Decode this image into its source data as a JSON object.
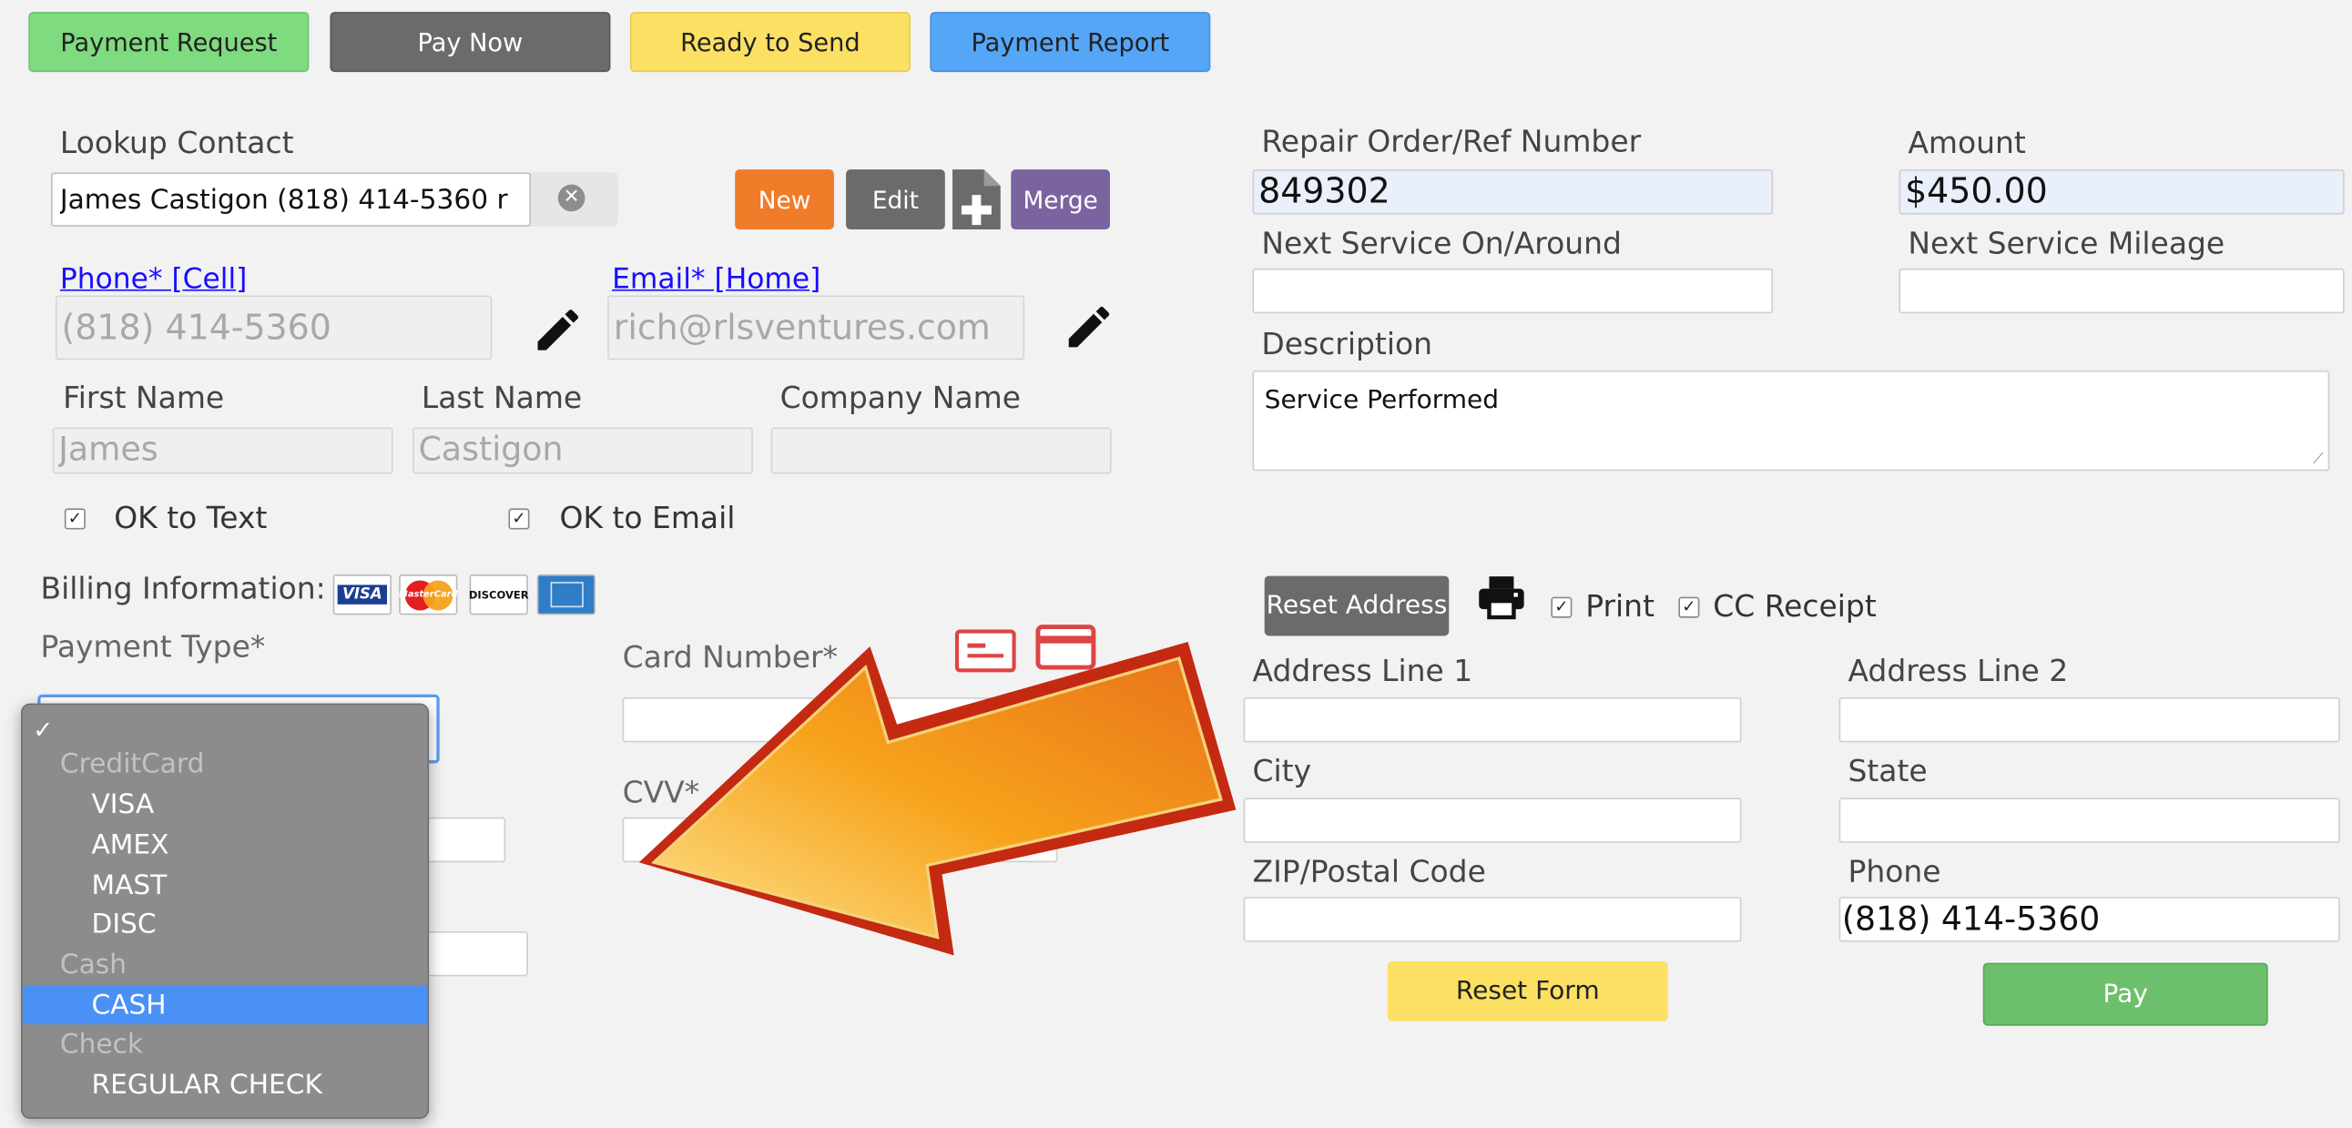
{
  "top_buttons": {
    "payment_request": "Payment Request",
    "pay_now": "Pay Now",
    "ready_to_send": "Ready to Send",
    "payment_report": "Payment Report"
  },
  "lookup": {
    "label": "Lookup Contact",
    "value": "James Castigon (818) 414-5360 r",
    "buttons": {
      "new": "New",
      "edit": "Edit",
      "merge": "Merge"
    }
  },
  "contact": {
    "phone_link": "Phone* [Cell]",
    "phone_value": "(818) 414-5360",
    "email_link": "Email* [Home]",
    "email_value": "rich@rlsventures.com",
    "first_name_label": "First Name",
    "first_name_value": "James",
    "last_name_label": "Last Name",
    "last_name_value": "Castigon",
    "company_label": "Company Name",
    "company_value": "",
    "ok_text_label": "OK to Text",
    "ok_email_label": "OK to Email"
  },
  "billing": {
    "label": "Billing Information:",
    "payment_type_label": "Payment Type*",
    "card_number_label": "Card Number*",
    "cvv_label": "CVV*",
    "cards": {
      "visa": "VISA",
      "mastercard": "MasterCard",
      "discover": "DISCOVER"
    }
  },
  "payment_dropdown": {
    "checkmark": "✓",
    "groups": [
      {
        "label": "CreditCard",
        "options": [
          "VISA",
          "AMEX",
          "MAST",
          "DISC"
        ]
      },
      {
        "label": "Cash",
        "options": [
          "CASH"
        ]
      },
      {
        "label": "Check",
        "options": [
          "REGULAR CHECK"
        ]
      }
    ],
    "highlighted": "CASH"
  },
  "order": {
    "ro_label": "Repair Order/Ref Number",
    "ro_value": "849302",
    "amount_label": "Amount",
    "amount_value": "$450.00",
    "next_service_label": "Next Service On/Around",
    "next_mileage_label": "Next Service Mileage",
    "description_label": "Description",
    "description_value": "Service Performed"
  },
  "address": {
    "reset_address": "Reset Address",
    "print_label": "Print",
    "cc_receipt_label": "CC Receipt",
    "line1_label": "Address Line 1",
    "line2_label": "Address Line 2",
    "city_label": "City",
    "state_label": "State",
    "zip_label": "ZIP/Postal Code",
    "phone_label": "Phone",
    "phone_value": "(818) 414-5360"
  },
  "actions": {
    "reset_form": "Reset Form",
    "pay": "Pay"
  },
  "colors": {
    "green": "#7fdb7f",
    "gray": "#6b6b6b",
    "yellow": "#fce063",
    "blue": "#55a6f6",
    "orange": "#f07b28",
    "purple": "#7b63a0",
    "pay_green": "#6cc06c",
    "highlight": "#4a90f5"
  }
}
